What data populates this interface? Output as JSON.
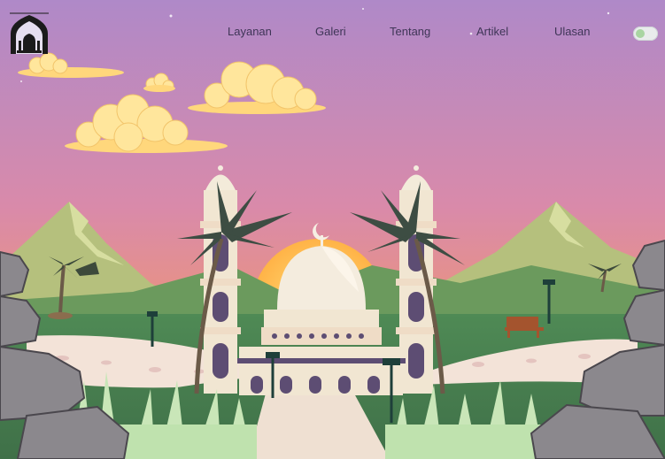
{
  "nav": {
    "items": [
      {
        "label": "Layanan"
      },
      {
        "label": "Galeri"
      },
      {
        "label": "Tentang"
      },
      {
        "label": "Artikel"
      },
      {
        "label": "Ulasan"
      }
    ]
  },
  "theme_toggle": {
    "state": "off"
  },
  "colors": {
    "sky_top": "#b18ac6",
    "sky_mid": "#dc8aa6",
    "sky_bottom": "#f3a067",
    "sun": "#ffc85a",
    "cloud": "#ffe59a",
    "mountain": "#b8c483",
    "grass": "#5f9159",
    "path": "#f2e2d7",
    "mosque_cream": "#f3ead6",
    "mosque_purple": "#5f4f74",
    "rock": "#8e8b8e",
    "nav_text": "#3f3557"
  },
  "icons": [
    "mosque-logo-icon",
    "theme-toggle-icon"
  ]
}
